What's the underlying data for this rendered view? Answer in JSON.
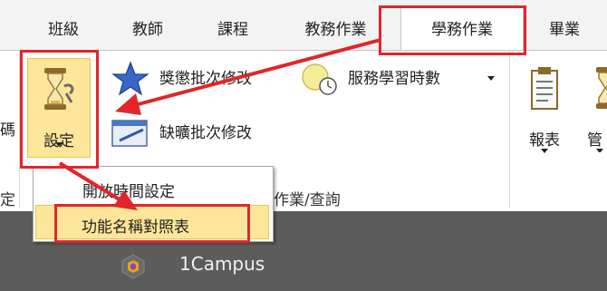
{
  "tabs": [
    {
      "label": "班級"
    },
    {
      "label": "教師"
    },
    {
      "label": "課程"
    },
    {
      "label": "教務作業"
    },
    {
      "label": "學務作業"
    },
    {
      "label": "畢業"
    }
  ],
  "ribbon": {
    "partial_left_label": "碼",
    "partial_left_group": "定",
    "settings_label": "設定",
    "award_batch_label": "獎懲批次修改",
    "absence_batch_label": "缺曠批次修改",
    "service_hours_label": "服務學習時數",
    "group_label": "作業/查詢",
    "report_label": "報表",
    "manage_label_partial": "管"
  },
  "settings_menu": {
    "items": [
      {
        "label": "開放時間設定"
      },
      {
        "label": "功能名稱對照表"
      }
    ]
  },
  "footer": {
    "app_name": "1Campus"
  },
  "colors": {
    "annotation_red": "#e0262b",
    "highlight_yellow": "#fde69a",
    "taskbar_gray": "#5c5c5c"
  }
}
